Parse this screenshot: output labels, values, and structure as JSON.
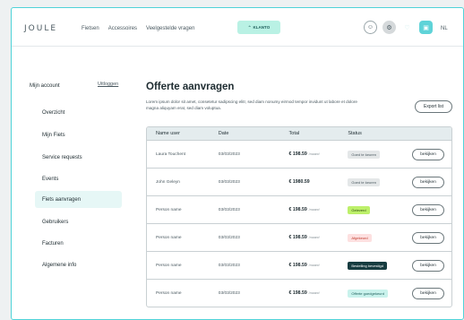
{
  "header": {
    "logo": "JOULE",
    "nav": [
      "Fietsen",
      "Accessoires",
      "Veelgestelde vragen"
    ],
    "brand_button": "KLANTO",
    "language": "NL"
  },
  "sidebar": {
    "account_label": "Mijn account",
    "logout_label": "Uitloggen",
    "items": [
      {
        "label": "Overzicht",
        "active": false
      },
      {
        "label": "Mijn Fiets",
        "active": false
      },
      {
        "label": "Service requests",
        "active": false
      },
      {
        "label": "Events",
        "active": false
      },
      {
        "label": "Fiets aanvragen",
        "active": true
      },
      {
        "label": "Gebruikers",
        "active": false
      },
      {
        "label": "Facturen",
        "active": false
      },
      {
        "label": "Algemene info",
        "active": false
      }
    ]
  },
  "main": {
    "title": "Offerte aanvragen",
    "description": "Lorem ipsum dolor sit amet, consetetur sadipscing elitr, sed diam nonumy eirmod tempor invidunt ut labore et dolore magna aliquyam erat, sed diam voluptua.",
    "export_label": "Export list"
  },
  "table": {
    "headers": [
      "Name user",
      "Date",
      "Total",
      "Status",
      ""
    ],
    "rows": [
      {
        "name": "Laura Touchent",
        "date": "03/03/2023",
        "total": "€ 198.59",
        "suffix": "/maand",
        "status": "Goed te keuren",
        "status_bg": "#e4e7e8",
        "status_fg": "#4a5960",
        "action": "bekijken"
      },
      {
        "name": "John Geleyn",
        "date": "03/03/2023",
        "total": "€ 1980.59",
        "suffix": "",
        "status": "Goed te keuren",
        "status_bg": "#e4e7e8",
        "status_fg": "#4a5960",
        "action": "bekijken"
      },
      {
        "name": "Person name",
        "date": "03/03/2023",
        "total": "€ 198.59",
        "suffix": "/maand",
        "status": "Geleverd",
        "status_bg": "#bdf06a",
        "status_fg": "#2c4a0c",
        "action": "bekijken"
      },
      {
        "name": "Person name",
        "date": "03/03/2023",
        "total": "€ 198.59",
        "suffix": "/maand",
        "status": "Afgekeurd",
        "status_bg": "#fde0e0",
        "status_fg": "#c0392b",
        "action": "bekijken"
      },
      {
        "name": "Person name",
        "date": "03/03/2023",
        "total": "€ 198.59",
        "suffix": "/maand",
        "status": "Bestelling bevestigd",
        "status_bg": "#173c40",
        "status_fg": "#ffffff",
        "action": "bekijken"
      },
      {
        "name": "Person name",
        "date": "03/03/2023",
        "total": "€ 198.59",
        "suffix": "/maand",
        "status": "Offerte goedgekeurd",
        "status_bg": "#c9f2ec",
        "status_fg": "#1d5e5a",
        "action": "bekijken"
      }
    ]
  }
}
